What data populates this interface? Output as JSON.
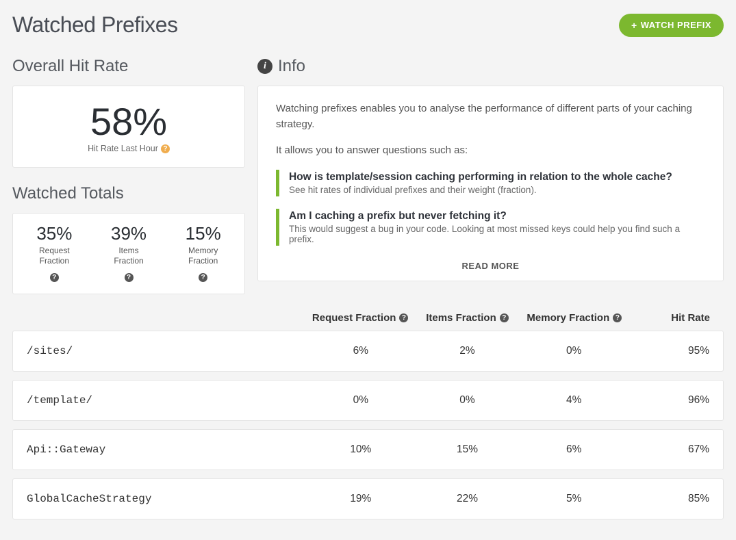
{
  "header": {
    "title": "Watched Prefixes",
    "watch_button_label": "WATCH PREFIX"
  },
  "overall": {
    "section_title": "Overall Hit Rate",
    "value": "58%",
    "sub_label": "Hit Rate Last Hour"
  },
  "totals": {
    "section_title": "Watched Totals",
    "items": [
      {
        "value": "35%",
        "label_line1": "Request",
        "label_line2": "Fraction"
      },
      {
        "value": "39%",
        "label_line1": "Items",
        "label_line2": "Fraction"
      },
      {
        "value": "15%",
        "label_line1": "Memory",
        "label_line2": "Fraction"
      }
    ]
  },
  "info": {
    "section_title": "Info",
    "para1": "Watching prefixes enables you to analyse the performance of different parts of your caching strategy.",
    "para2": "It allows you to answer questions such as:",
    "callouts": [
      {
        "title": "How is template/session caching performing in relation to the whole cache?",
        "sub": "See hit rates of individual prefixes and their weight (fraction)."
      },
      {
        "title": "Am I caching a prefix but never fetching it?",
        "sub": "This would suggest a bug in your code. Looking at most missed keys could help you find such a prefix."
      }
    ],
    "read_more": "READ MORE"
  },
  "table": {
    "columns": {
      "request_fraction": "Request Fraction",
      "items_fraction": "Items Fraction",
      "memory_fraction": "Memory Fraction",
      "hit_rate": "Hit Rate"
    },
    "rows": [
      {
        "prefix": "/sites/",
        "request_fraction": "6%",
        "items_fraction": "2%",
        "memory_fraction": "0%",
        "hit_rate": "95%"
      },
      {
        "prefix": "/template/",
        "request_fraction": "0%",
        "items_fraction": "0%",
        "memory_fraction": "4%",
        "hit_rate": "96%"
      },
      {
        "prefix": "Api::Gateway",
        "request_fraction": "10%",
        "items_fraction": "15%",
        "memory_fraction": "6%",
        "hit_rate": "67%"
      },
      {
        "prefix": "GlobalCacheStrategy",
        "request_fraction": "19%",
        "items_fraction": "22%",
        "memory_fraction": "5%",
        "hit_rate": "85%"
      }
    ]
  },
  "colors": {
    "accent_green": "#7cb82f",
    "help_orange": "#f0ad4e"
  }
}
